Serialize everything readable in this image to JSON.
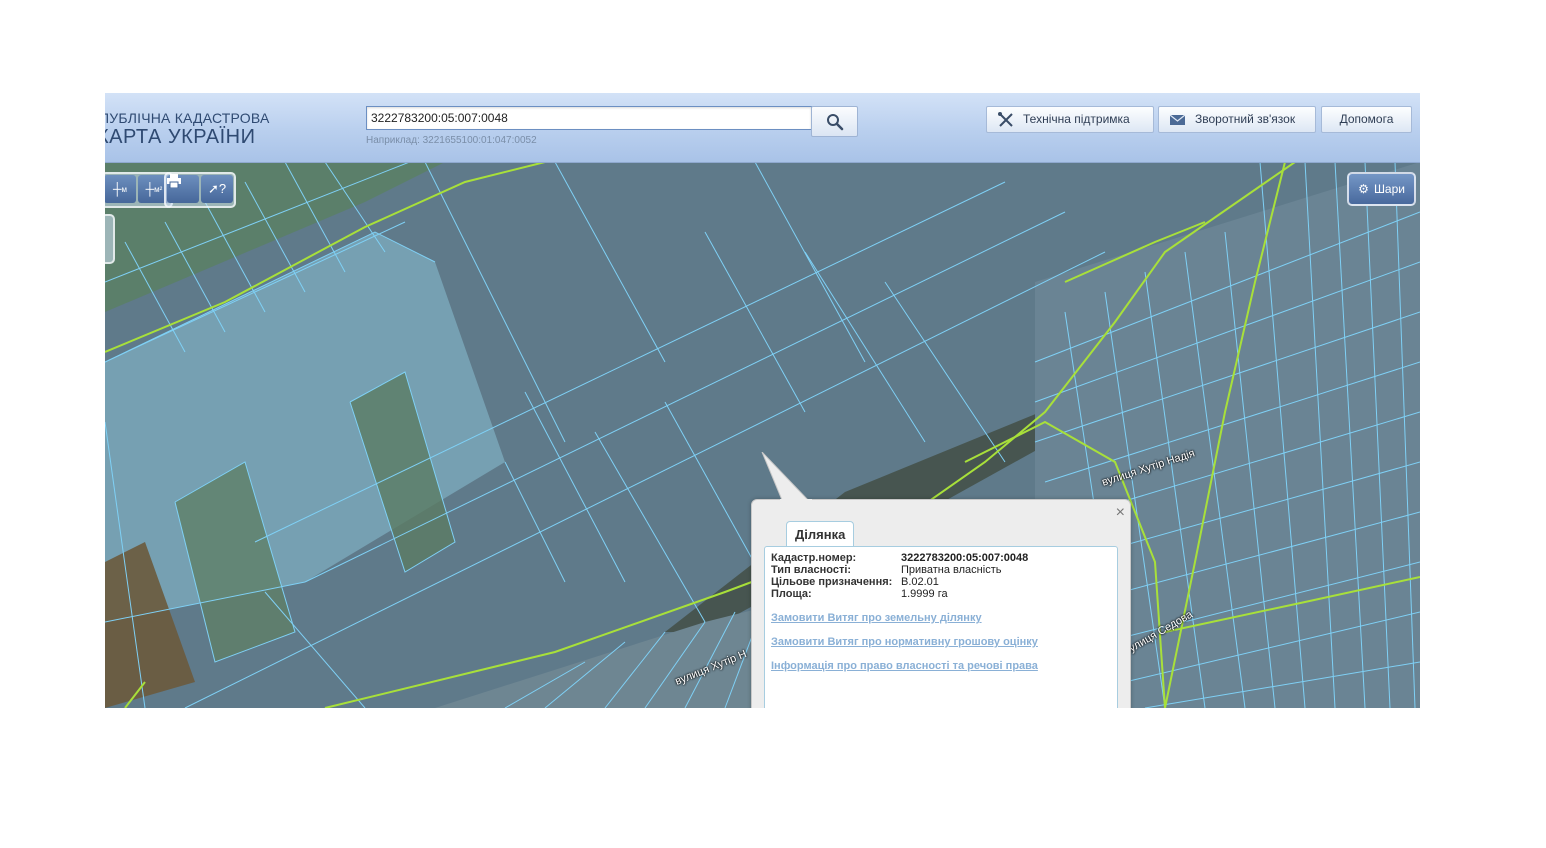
{
  "header": {
    "logo_line1": "ПУБЛІЧНА КАДАСТРОВА",
    "logo_line2": "КАРТА УКРАЇНИ",
    "search_value": "3222783200:05:007:0048",
    "search_hint": "Наприклад: 3221655100:01:047:0052",
    "support_label": "Технічна підтримка",
    "feedback_label": "Зворотний зв'язок",
    "help_label": "Допомога"
  },
  "toolbar": {
    "measure_length_label": "м",
    "measure_area_label": "м²"
  },
  "layers_label": "Шари",
  "streets": [
    "вулиця Хутір Надія",
    "вулиця Хутір Н",
    "вулиця Седова"
  ],
  "popup": {
    "tab_label": "Ділянка",
    "close_symbol": "×",
    "cadastral_label": "Кадастр.номер:",
    "cadastral_value": "3222783200:05:007:0048",
    "ownership_label": "Тип власності:",
    "ownership_value": "Приватна власність",
    "purpose_label": "Цільове призначення:",
    "purpose_value": "В.02.01",
    "area_label": "Площа:",
    "area_value": "1.9999 га",
    "link1": "Замовити Витяг про земельну ділянку",
    "link2": "Замовити Витяг про нормативну грошову оцінку",
    "link3": "Інформація про право власності та речові права"
  },
  "colors": {
    "parcel_border": "#7fd0f5",
    "road_line": "#a8e03a",
    "header_bg": "#b9cfee",
    "link": "#8ab0d6"
  }
}
